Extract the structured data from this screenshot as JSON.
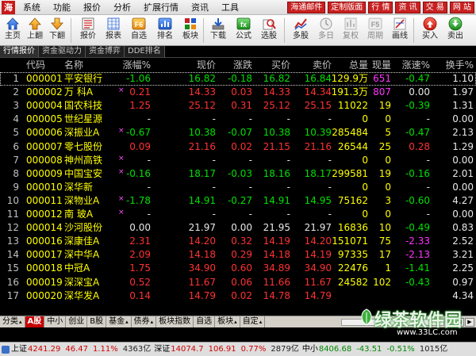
{
  "menubar": {
    "items": [
      {
        "label": "系统",
        "arrow": false
      },
      {
        "label": "功能",
        "arrow": false
      },
      {
        "label": "报价",
        "arrow": false
      },
      {
        "label": "分析",
        "arrow": false
      },
      {
        "label": "扩展行情",
        "arrow": false
      },
      {
        "label": "资讯",
        "arrow": false
      },
      {
        "label": "工具",
        "arrow": false
      }
    ],
    "red_buttons": [
      "海通邮件",
      "定制版面",
      "行 情",
      "资 讯",
      "交 易",
      "网 站"
    ]
  },
  "toolbar": {
    "buttons": [
      {
        "label": "主页",
        "icon": "home-icon"
      },
      {
        "label": "上翻",
        "icon": "arrow-up-icon"
      },
      {
        "label": "下翻",
        "icon": "arrow-down-icon"
      },
      {
        "label": "报价",
        "icon": "quote-icon"
      },
      {
        "label": "报表",
        "icon": "report-icon"
      },
      {
        "label": "自选",
        "icon": "f6-icon"
      },
      {
        "label": "排名",
        "icon": "rank-icon"
      },
      {
        "label": "板块",
        "icon": "sector-icon"
      },
      {
        "label": "下载",
        "icon": "download-icon"
      },
      {
        "label": "公式",
        "icon": "formula-icon"
      },
      {
        "label": "选股",
        "icon": "stock-picker-icon"
      },
      {
        "label": "多股",
        "icon": "multi-stock-icon"
      },
      {
        "label": "多日",
        "icon": "multi-day-icon"
      },
      {
        "label": "复权",
        "icon": "adjust-icon"
      },
      {
        "label": "周期",
        "icon": "period-icon"
      },
      {
        "label": "画线",
        "icon": "draw-line-icon"
      },
      {
        "label": "买入",
        "icon": "buy-icon"
      },
      {
        "label": "卖出",
        "icon": "sell-icon"
      }
    ],
    "f6_text": "F6",
    "f5_text": "F5"
  },
  "subtabs": [
    "行情报价",
    "资金驱动力",
    "资金博弈",
    "DDE排名"
  ],
  "table": {
    "headers": [
      "代码",
      "名称",
      "涨幅%",
      "现价",
      "涨跌",
      "买价",
      "卖价",
      "总量",
      "现量",
      "涨速%",
      "换手%"
    ],
    "rows": [
      {
        "idx": "1",
        "code": "000001",
        "name": "平安银行",
        "mark": "",
        "chgp": "-1.06",
        "price": "16.82",
        "chg": "-0.18",
        "bid": "16.82",
        "ask": "16.84",
        "vol": "129.9万",
        "cur": "651",
        "spd": "-0.47",
        "turn": "1.10",
        "dir": "dn",
        "cur_dir": "mg",
        "spd_dir": "dn"
      },
      {
        "idx": "2",
        "code": "000002",
        "name": "万  科A",
        "mark": "×",
        "chgp": "0.21",
        "price": "14.33",
        "chg": "0.03",
        "bid": "14.33",
        "ask": "14.34",
        "vol": "191.3万",
        "cur": "807",
        "spd": "0.00",
        "turn": "1.97",
        "dir": "up",
        "cur_dir": "mg",
        "spd_dir": "eq"
      },
      {
        "idx": "3",
        "code": "000004",
        "name": "国农科技",
        "mark": "",
        "chgp": "1.25",
        "price": "25.12",
        "chg": "0.31",
        "bid": "25.12",
        "ask": "25.15",
        "vol": "11022",
        "cur": "19",
        "spd": "-0.39",
        "turn": "1.31",
        "dir": "up",
        "cur_dir": "yl",
        "spd_dir": "dn"
      },
      {
        "idx": "4",
        "code": "000005",
        "name": "世纪星源",
        "mark": "",
        "chgp": "-",
        "price": "-",
        "chg": "-",
        "bid": "-",
        "ask": "-",
        "vol": "0",
        "cur": "0",
        "spd": "-",
        "turn": "0.00",
        "dir": "eq",
        "cur_dir": "yl",
        "spd_dir": "eq"
      },
      {
        "idx": "5",
        "code": "000006",
        "name": "深振业A",
        "mark": "×",
        "chgp": "-0.67",
        "price": "10.38",
        "chg": "-0.07",
        "bid": "10.38",
        "ask": "10.39",
        "vol": "285484",
        "cur": "5",
        "spd": "-0.47",
        "turn": "2.13",
        "dir": "dn",
        "cur_dir": "yl",
        "spd_dir": "dn"
      },
      {
        "idx": "6",
        "code": "000007",
        "name": "零七股份",
        "mark": "",
        "chgp": "0.09",
        "price": "21.16",
        "chg": "0.02",
        "bid": "21.15",
        "ask": "21.16",
        "vol": "26544",
        "cur": "25",
        "spd": "0.28",
        "turn": "1.29",
        "dir": "up",
        "cur_dir": "yl",
        "spd_dir": "up"
      },
      {
        "idx": "7",
        "code": "000008",
        "name": "神州高铁",
        "mark": "×",
        "chgp": "-",
        "price": "-",
        "chg": "-",
        "bid": "-",
        "ask": "-",
        "vol": "0",
        "cur": "0",
        "spd": "-",
        "turn": "0.00",
        "dir": "eq",
        "cur_dir": "yl",
        "spd_dir": "eq"
      },
      {
        "idx": "8",
        "code": "000009",
        "name": "中国宝安",
        "mark": "×",
        "chgp": "-0.16",
        "price": "18.17",
        "chg": "-0.03",
        "bid": "18.16",
        "ask": "18.17",
        "vol": "299581",
        "cur": "19",
        "spd": "-0.16",
        "turn": "2.01",
        "dir": "dn",
        "cur_dir": "yl",
        "spd_dir": "dn"
      },
      {
        "idx": "9",
        "code": "000010",
        "name": "深华新",
        "mark": "",
        "chgp": "-",
        "price": "-",
        "chg": "-",
        "bid": "-",
        "ask": "-",
        "vol": "0",
        "cur": "0",
        "spd": "-",
        "turn": "0.00",
        "dir": "eq",
        "cur_dir": "yl",
        "spd_dir": "eq"
      },
      {
        "idx": "10",
        "code": "000011",
        "name": "深物业A",
        "mark": "×",
        "chgp": "-1.78",
        "price": "14.91",
        "chg": "-0.27",
        "bid": "14.91",
        "ask": "14.95",
        "vol": "75162",
        "cur": "3",
        "spd": "-0.60",
        "turn": "4.27",
        "dir": "dn",
        "cur_dir": "yl",
        "spd_dir": "dn"
      },
      {
        "idx": "11",
        "code": "000012",
        "name": "南  玻A",
        "mark": "×",
        "chgp": "-",
        "price": "-",
        "chg": "-",
        "bid": "-",
        "ask": "-",
        "vol": "0",
        "cur": "0",
        "spd": "-",
        "turn": "0.00",
        "dir": "eq",
        "cur_dir": "yl",
        "spd_dir": "eq"
      },
      {
        "idx": "12",
        "code": "000014",
        "name": "沙河股份",
        "mark": "",
        "chgp": "0.00",
        "price": "21.97",
        "chg": "0.00",
        "bid": "21.95",
        "ask": "21.97",
        "vol": "16836",
        "cur": "10",
        "spd": "-0.49",
        "turn": "0.83",
        "dir": "eq",
        "cur_dir": "yl",
        "spd_dir": "dn"
      },
      {
        "idx": "13",
        "code": "000016",
        "name": "深康佳A",
        "mark": "",
        "chgp": "2.31",
        "price": "14.20",
        "chg": "0.32",
        "bid": "14.19",
        "ask": "14.20",
        "vol": "151071",
        "cur": "75",
        "spd": "-2.33",
        "turn": "2.52",
        "dir": "up",
        "cur_dir": "yl",
        "spd_dir": "mg"
      },
      {
        "idx": "14",
        "code": "000017",
        "name": "深中华A",
        "mark": "",
        "chgp": "2.09",
        "price": "14.18",
        "chg": "0.29",
        "bid": "14.18",
        "ask": "14.19",
        "vol": "97335",
        "cur": "17",
        "spd": "-2.13",
        "turn": "3.21",
        "dir": "up",
        "cur_dir": "yl",
        "spd_dir": "mg"
      },
      {
        "idx": "15",
        "code": "000018",
        "name": "中冠A",
        "mark": "",
        "chgp": "1.75",
        "price": "34.90",
        "chg": "0.60",
        "bid": "34.89",
        "ask": "34.90",
        "vol": "22476",
        "cur": "1",
        "spd": "-1.41",
        "turn": "2.25",
        "dir": "up",
        "cur_dir": "yl",
        "spd_dir": "dn"
      },
      {
        "idx": "16",
        "code": "000019",
        "name": "深深宝A",
        "mark": "",
        "chgp": "0.52",
        "price": "11.67",
        "chg": "0.06",
        "bid": "11.66",
        "ask": "11.67",
        "vol": "24582",
        "cur": "102",
        "spd": "-0.43",
        "turn": "0.97",
        "dir": "up",
        "cur_dir": "yl",
        "spd_dir": "dn"
      },
      {
        "idx": "17",
        "code": "000020",
        "name": "深华发A",
        "mark": "",
        "chgp": "0.14",
        "price": "14.79",
        "chg": "0.02",
        "bid": "14.78",
        "ask": "14.79",
        "vol": "",
        "cur": "",
        "spd": "",
        "turn": "4.34",
        "dir": "up",
        "cur_dir": "yl",
        "spd_dir": "dn"
      }
    ]
  },
  "sheettabs": [
    {
      "label": "分类",
      "arrow": true,
      "active": false
    },
    {
      "label": "A股",
      "arrow": false,
      "active": true
    },
    {
      "label": "中小",
      "arrow": false,
      "active": false
    },
    {
      "label": "创业",
      "arrow": false,
      "active": false
    },
    {
      "label": "B股",
      "arrow": false,
      "active": false
    },
    {
      "label": "基金",
      "arrow": true,
      "active": false
    },
    {
      "label": "债券",
      "arrow": true,
      "active": false
    },
    {
      "label": "板块指数",
      "arrow": false,
      "active": false
    },
    {
      "label": "自选",
      "arrow": false,
      "active": false
    },
    {
      "label": "板块",
      "arrow": true,
      "active": false
    },
    {
      "label": "自定",
      "arrow": true,
      "active": false
    }
  ],
  "statusbar": {
    "sh_label": "上证",
    "sh_index": "4241.29",
    "sh_chg": "46.47",
    "sh_pct": "1.11%",
    "sh_amt": "4363亿",
    "sz_label": "深证",
    "sz_index": "14074.7",
    "sz_chg": "106.91",
    "sz_pct": "0.77%",
    "sz_amt": "2879亿",
    "zx_label": "中小",
    "zx_index": "8406.68",
    "zx_chg": "-43.51",
    "zx_pct": "-0.51%",
    "zx_amt": "1015亿"
  },
  "watermark": {
    "title": "绿茶软件园",
    "url": "www.33LC.com"
  },
  "colors": {
    "up": "#ff3232",
    "down": "#00e000",
    "code": "#ffff00",
    "accent_red": "#c82121",
    "background": "#000000"
  }
}
